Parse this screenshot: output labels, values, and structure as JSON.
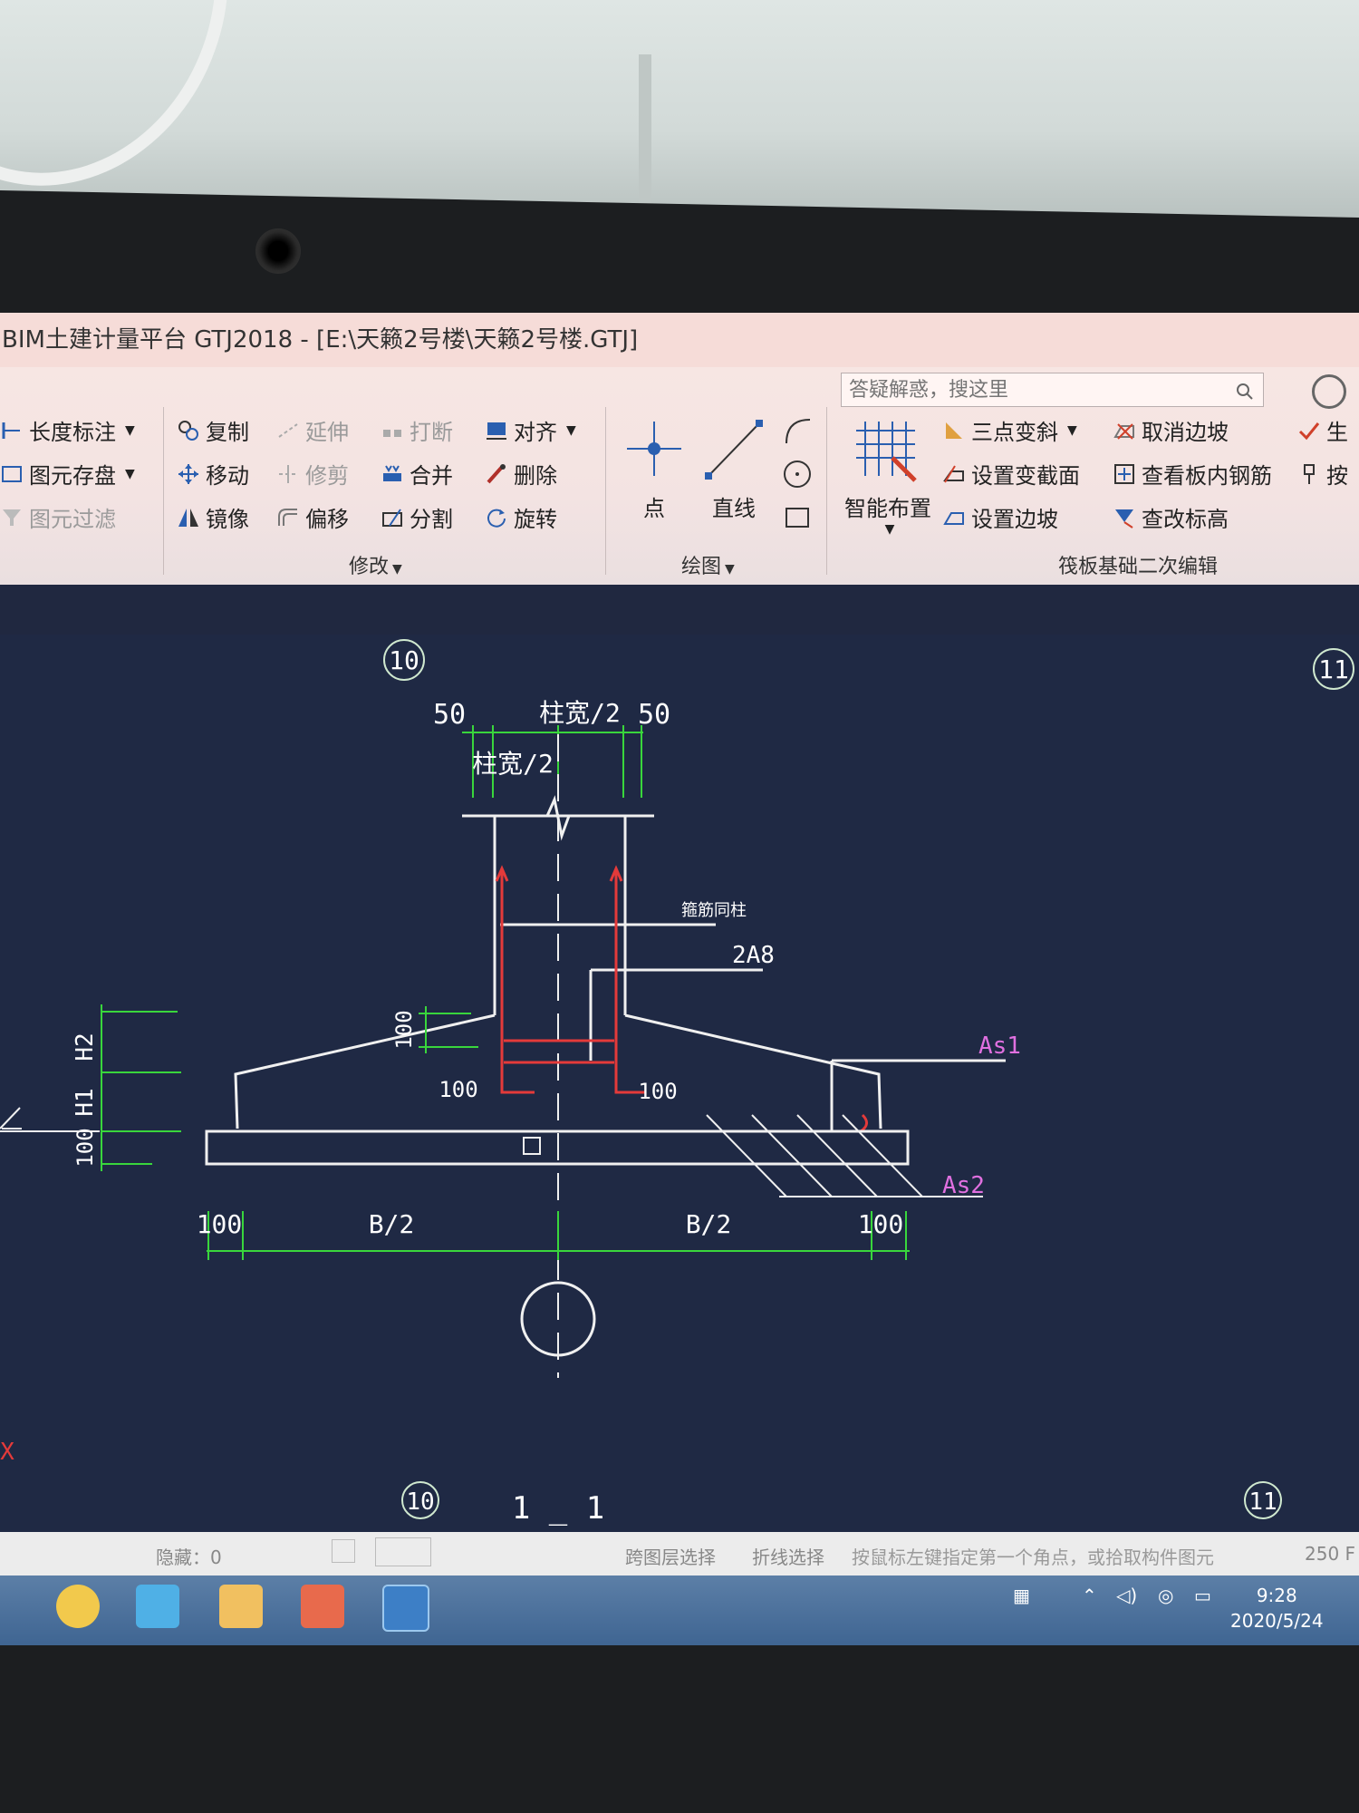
{
  "window": {
    "title": "BIM土建计量平台 GTJ2018 - [E:\\天籁2号楼\\天籁2号楼.GTJ]"
  },
  "search": {
    "placeholder": "答疑解惑，搜这里"
  },
  "ribbon": {
    "left": {
      "dimension": "长度标注",
      "save": "图元存盘",
      "filter": "图元过滤"
    },
    "modify": {
      "copy": "复制",
      "extend": "延伸",
      "break": "打断",
      "align": "对齐",
      "move": "移动",
      "trim": "修剪",
      "merge": "合并",
      "delete": "删除",
      "mirror": "镜像",
      "offset": "偏移",
      "split": "分割",
      "rotate": "旋转",
      "group_label": "修改"
    },
    "draw": {
      "point": "点",
      "line": "直线",
      "group_label": "绘图"
    },
    "raft": {
      "smart": "智能布置",
      "three_point": "三点变斜",
      "set_section": "设置变截面",
      "set_slope": "设置边坡",
      "cancel_slope": "取消边坡",
      "view_rebar": "查看板内钢筋",
      "edit_elevation": "查改标高",
      "gen": "生",
      "by": "按",
      "group_label": "筏板基础二次编辑"
    }
  },
  "drawing": {
    "axis_top_left": "10",
    "axis_top_right": "11",
    "axis_bottom_left": "10",
    "axis_bottom_right": "11",
    "dim_50_left": "50",
    "dim_top_half": "柱宽/2",
    "dim_50_right": "50",
    "dim_half2": "柱宽/2",
    "label_hooprebar": "箍筋同柱",
    "label_2a8": "2A8",
    "label_as1": "As1",
    "label_as2": "As2",
    "label_h2": "H2",
    "label_h1": "H1",
    "label_100_side": "100",
    "label_100_slope": "100",
    "label_100_left": "100",
    "label_100_right": "100",
    "dim_100_bl": "100",
    "dim_b2_left": "B/2",
    "dim_b2_right": "B/2",
    "dim_100_br": "100",
    "section_label": "1 _ 1",
    "x_marker": "X"
  },
  "statusbar": {
    "hidden": "隐藏：0",
    "cross_layer": "跨图层选择",
    "polyline_select": "折线选择",
    "hint": "按鼠标左键指定第一个角点，或拾取构件图元",
    "fps": "250 F"
  },
  "taskbar": {
    "time": "9:28",
    "date": "2020/5/24"
  },
  "colors": {
    "canvas_bg": "#1f2944",
    "rebar_red": "#e43a3a",
    "dim_green": "#39d63c",
    "label_magenta": "#e070e0",
    "line_white": "#f0f0f0"
  }
}
